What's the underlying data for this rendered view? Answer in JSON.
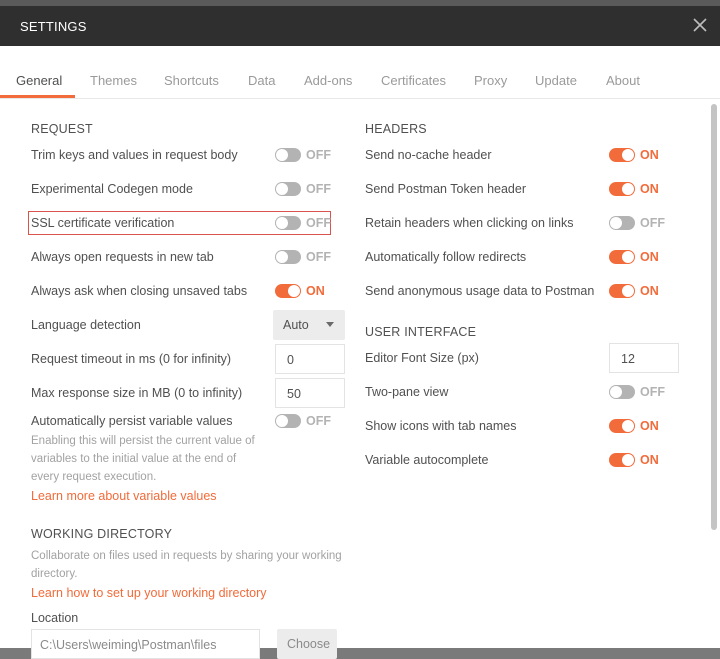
{
  "window": {
    "title": "SETTINGS"
  },
  "tabs": [
    {
      "label": "General",
      "active": true
    },
    {
      "label": "Themes"
    },
    {
      "label": "Shortcuts"
    },
    {
      "label": "Data"
    },
    {
      "label": "Add-ons"
    },
    {
      "label": "Certificates"
    },
    {
      "label": "Proxy"
    },
    {
      "label": "Update"
    },
    {
      "label": "About"
    }
  ],
  "request": {
    "heading": "REQUEST",
    "trim_keys": {
      "label": "Trim keys and values in request body",
      "state": "OFF"
    },
    "codegen": {
      "label": "Experimental Codegen mode",
      "state": "OFF"
    },
    "ssl": {
      "label": "SSL certificate verification",
      "state": "OFF"
    },
    "new_tab": {
      "label": "Always open requests in new tab",
      "state": "OFF"
    },
    "ask_close": {
      "label": "Always ask when closing unsaved tabs",
      "state": "ON"
    },
    "language": {
      "label": "Language detection",
      "value": "Auto"
    },
    "timeout": {
      "label": "Request timeout in ms (0 for infinity)",
      "value": "0"
    },
    "max_size": {
      "label": "Max response size in MB (0 to infinity)",
      "value": "50"
    },
    "persist": {
      "label": "Automatically persist variable values",
      "state": "OFF",
      "help": "Enabling this will persist the current value of variables to the initial value at the end of every request execution.",
      "link": "Learn more about variable values"
    }
  },
  "working_dir": {
    "heading": "WORKING DIRECTORY",
    "help": "Collaborate on files used in requests by sharing your working directory.",
    "link": "Learn how to set up your working directory",
    "location_label": "Location",
    "location_value": "C:\\Users\\weiming\\Postman\\files",
    "choose_label": "Choose"
  },
  "headers": {
    "heading": "HEADERS",
    "no_cache": {
      "label": "Send no-cache header",
      "state": "ON"
    },
    "token": {
      "label": "Send Postman Token header",
      "state": "ON"
    },
    "retain": {
      "label": "Retain headers when clicking on links",
      "state": "OFF"
    },
    "redirects": {
      "label": "Automatically follow redirects",
      "state": "ON"
    },
    "usage": {
      "label": "Send anonymous usage data to Postman",
      "state": "ON"
    }
  },
  "ui": {
    "heading": "USER INTERFACE",
    "font_size": {
      "label": "Editor Font Size (px)",
      "value": "12"
    },
    "two_pane": {
      "label": "Two-pane view",
      "state": "OFF"
    },
    "icons": {
      "label": "Show icons with tab names",
      "state": "ON"
    },
    "autocomplete": {
      "label": "Variable autocomplete",
      "state": "ON"
    }
  },
  "colors": {
    "accent": "#f26b3a",
    "titlebar": "#2f2f2f",
    "toggle_off": "#b3b3b3"
  },
  "icons": {
    "close": "close-icon"
  }
}
